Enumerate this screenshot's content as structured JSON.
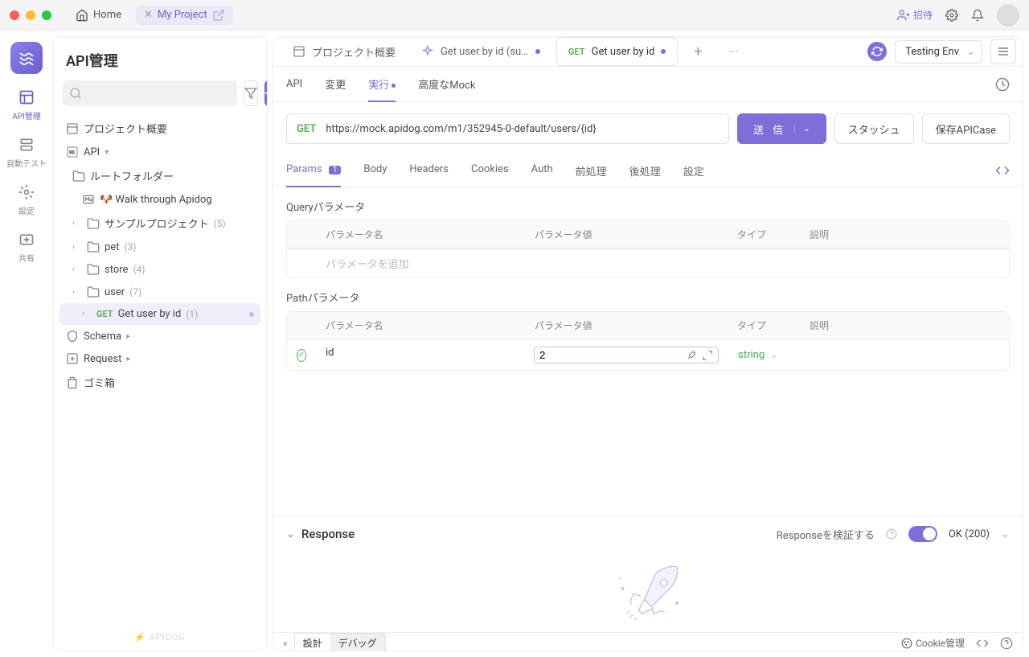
{
  "titleBar": {
    "home": "Home",
    "project": "My Project",
    "invite": "招待"
  },
  "leftRail": {
    "items": [
      {
        "label": "API管理"
      },
      {
        "label": "自動テスト"
      },
      {
        "label": "設定"
      },
      {
        "label": "共有"
      }
    ]
  },
  "sidebar": {
    "title": "API管理",
    "searchPlaceholder": "",
    "projectOverview": "プロジェクト概要",
    "apiRoot": "API",
    "rootFolder": "ルートフォルダー",
    "walkThrough": "🐶 Walk through Apidog",
    "folders": [
      {
        "name": "サンプルプロジェクト",
        "count": "(5)"
      },
      {
        "name": "pet",
        "count": "(3)"
      },
      {
        "name": "store",
        "count": "(4)"
      },
      {
        "name": "user",
        "count": "(7)"
      }
    ],
    "getUser": {
      "method": "GET",
      "name": "Get user by id",
      "count": "(1)"
    },
    "schema": "Schema",
    "request": "Request",
    "trash": "ゴミ箱",
    "brand": "APIDOG"
  },
  "tabs": {
    "overview": "プロジェクト概要",
    "getUserSu": "Get user by id (su...",
    "getUserMethod": "GET",
    "getUser": "Get user by id",
    "env": "Testing Env"
  },
  "subtabs": {
    "api": "API",
    "change": "変更",
    "run": "実行",
    "mock": "高度なMock"
  },
  "urlRow": {
    "method": "GET",
    "url": "https://mock.apidog.com/m1/352945-0-default/users/{id}",
    "send": "送 信",
    "stash": "スタッシュ",
    "saveCase": "保存APICase"
  },
  "paramTabs": {
    "params": "Params",
    "paramsBadge": "1",
    "body": "Body",
    "headers": "Headers",
    "cookies": "Cookies",
    "auth": "Auth",
    "pre": "前処理",
    "post": "後処理",
    "settings": "設定"
  },
  "queryParams": {
    "title": "Queryパラメータ",
    "headers": {
      "name": "パラメータ名",
      "value": "パラメータ値",
      "type": "タイプ",
      "desc": "説明"
    },
    "placeholder": "パラメータを追加"
  },
  "pathParams": {
    "title": "Pathパラメータ",
    "headers": {
      "name": "パラメータ名",
      "value": "パラメータ値",
      "type": "タイプ",
      "desc": "説明"
    },
    "rows": [
      {
        "name": "id",
        "value": "2",
        "type": "string"
      }
    ]
  },
  "response": {
    "title": "Response",
    "validate": "Responseを検証する",
    "status": "OK (200)"
  },
  "footer": {
    "design": "設計",
    "debug": "デバッグ",
    "cookie": "Cookie管理"
  }
}
